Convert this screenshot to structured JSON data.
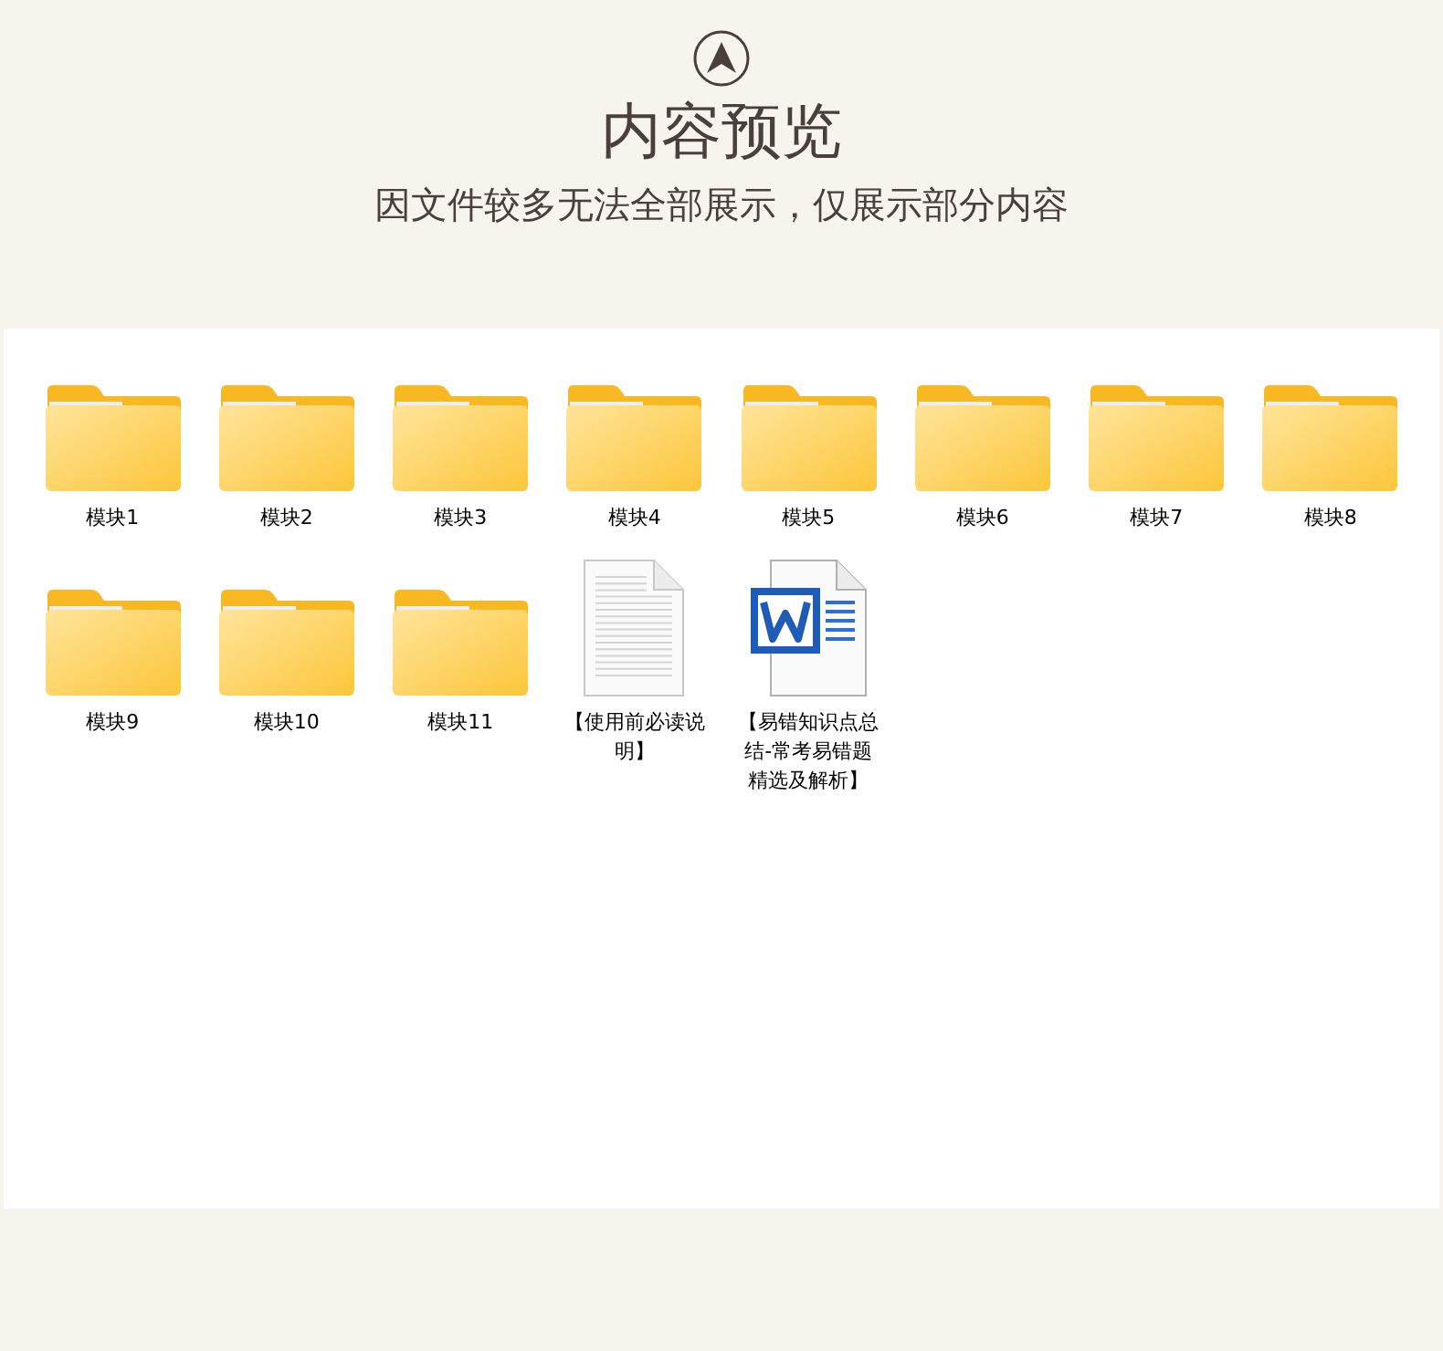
{
  "header": {
    "title": "内容预览",
    "subtitle": "因文件较多无法全部展示，仅展示部分内容"
  },
  "files": [
    {
      "kind": "folder",
      "name": "模块1"
    },
    {
      "kind": "folder",
      "name": "模块2"
    },
    {
      "kind": "folder",
      "name": "模块3"
    },
    {
      "kind": "folder",
      "name": "模块4"
    },
    {
      "kind": "folder",
      "name": "模块5"
    },
    {
      "kind": "folder",
      "name": "模块6"
    },
    {
      "kind": "folder",
      "name": "模块7"
    },
    {
      "kind": "folder",
      "name": "模块8"
    },
    {
      "kind": "folder",
      "name": "模块9"
    },
    {
      "kind": "folder",
      "name": "模块10"
    },
    {
      "kind": "folder",
      "name": "模块11"
    },
    {
      "kind": "text",
      "name": "【使用前必读说明】"
    },
    {
      "kind": "word",
      "name": "【易错知识点总结-常考易错题精选及解析】"
    }
  ]
}
